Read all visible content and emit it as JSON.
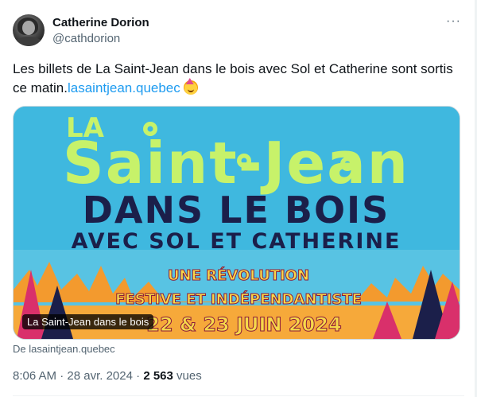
{
  "author": {
    "name": "Catherine Dorion",
    "handle": "@cathdorion"
  },
  "menu_glyph": "···",
  "tweet": {
    "text_before_link": "Les billets de La Saint-Jean dans le bois avec Sol et Catherine sont sortis ce matin.",
    "link_text": "lasaintjean.quebec",
    "emoji": "partying-face-icon"
  },
  "poster": {
    "title_la": "LA",
    "title_main": "Saint-Jean",
    "line_dans": "DANS LE BOIS",
    "line_avec": "AVEC SOL ET CATHERINE",
    "line_revolution": "UNE RÉVOLUTION",
    "line_festive": "FESTIVE ET INDÉPENDANTISTE",
    "line_dates": "22 & 23 JUIN 2024",
    "colors": {
      "sky": "#3fb8df",
      "lime": "#c7f26a",
      "navy": "#1b1f4a",
      "orange": "#f39a2e",
      "yellow": "#f6d94a",
      "magenta": "#d9306b"
    }
  },
  "card": {
    "label": "La Saint-Jean dans le bois",
    "domain": "De lasaintjean.quebec"
  },
  "meta": {
    "time": "8:06 AM",
    "date": "28 avr. 2024",
    "views_count": "2 563",
    "views_label": "vues"
  }
}
